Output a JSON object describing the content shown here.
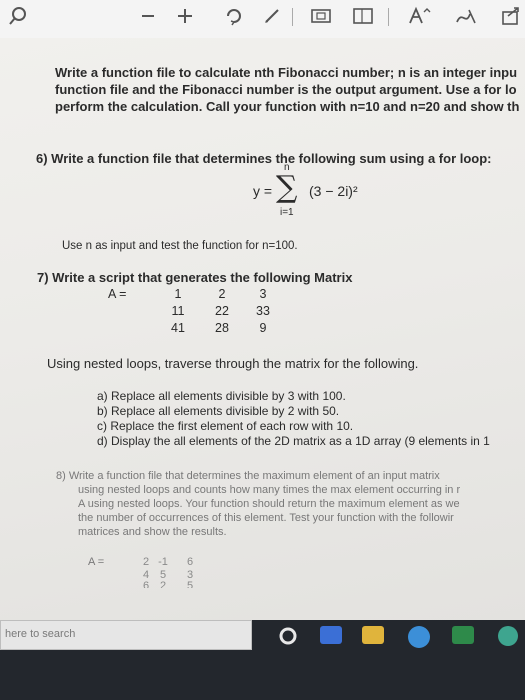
{
  "q5": {
    "line1": "Write a function file to calculate nth Fibonacci number; n is an integer inpu",
    "line2": "function file and the Fibonacci number is the output argument. Use a for lo",
    "line3": "perform the calculation. Call your function with n=10 and n=20 and show th"
  },
  "q6": {
    "title": "6)  Write a function file that determines the following sum using a for loop:",
    "formula_lhs": "y =",
    "formula_top": "n",
    "formula_body": "(3 − 2i)²",
    "formula_bottom": "i=1",
    "note": "Use n as input and test the function for n=100."
  },
  "q7": {
    "title": "7)  Write a script that generates the following Matrix",
    "matrix_label": "A =",
    "matrix": [
      [
        "1",
        "2",
        "3"
      ],
      [
        "11",
        "22",
        "33"
      ],
      [
        "41",
        "28",
        "9"
      ]
    ],
    "instruction": "Using nested loops, traverse through the matrix for the following.",
    "items": [
      "a)  Replace all elements divisible by 3 with 100.",
      "b)  Replace all elements divisible by 2 with 50.",
      "c)  Replace the first element of each row with 10.",
      "d)  Display the all elements of the 2D matrix as a 1D array (9 elements in 1"
    ]
  },
  "q8": {
    "lines": [
      "8)  Write a function file that determines the maximum element of an input matrix",
      "using nested loops and counts how many times the max element occurring in r",
      "A using nested loops. Your function should return the maximum element as we",
      "the number of occurrences of this element. Test your function with the followir",
      "matrices and show the results."
    ],
    "matrix_label": "A  =",
    "matrix": [
      [
        "2",
        "-1",
        "6"
      ],
      [
        "4",
        "5",
        "3"
      ],
      [
        "6",
        "2",
        "5"
      ]
    ]
  },
  "taskbar": {
    "search_text": "here to search"
  },
  "toolbar": {
    "icon_search": "search-icon",
    "icon_minus": "minus-icon",
    "icon_plus": "plus-icon",
    "icon_pen": "pen-icon",
    "icon_fullscreen": "fullscreen-icon",
    "icon_page": "page-icon",
    "icon_font": "font-size-icon",
    "icon_ink": "ink-icon",
    "icon_share": "share-icon"
  },
  "colors": {
    "paper": "#ecebe8",
    "text": "#2b2b2b",
    "toolbar": "#f4f4f4",
    "taskbar": "#23272d"
  }
}
